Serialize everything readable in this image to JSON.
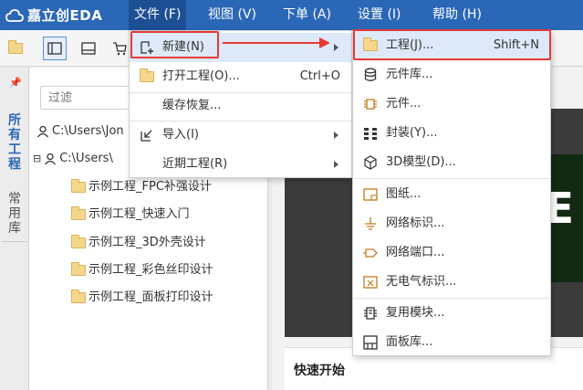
{
  "app": {
    "logo_text": "嘉立创EDA"
  },
  "menubar": {
    "file": "文件 (F)",
    "view": "视图 (V)",
    "order": "下单 (A)",
    "settings": "设置 (I)",
    "help": "帮助 (H)"
  },
  "panel": {
    "rail_tabs": [
      "所有工程",
      "常用库"
    ],
    "filter_placeholder": "过滤",
    "tree": [
      {
        "label": "C:\\Users\\Jon"
      },
      {
        "label": "C:\\Users\\"
      },
      {
        "label": "示例工程_FPC补强设计"
      },
      {
        "label": "示例工程_快速入门"
      },
      {
        "label": "示例工程_3D外壳设计"
      },
      {
        "label": "示例工程_彩色丝印设计"
      },
      {
        "label": "示例工程_面板打印设计"
      }
    ]
  },
  "file_menu": {
    "new": "新建(N)",
    "open_project": "打开工程(O)...",
    "open_shortcut": "Ctrl+O",
    "cache_restore": "缓存恢复...",
    "import": "导入(I)",
    "recent": "近期工程(R)"
  },
  "new_menu": {
    "items": [
      {
        "label": "工程(J)...",
        "shortcut": "Shift+N",
        "icon": "folder-icon"
      },
      {
        "label": "元件库...",
        "icon": "database-icon"
      },
      {
        "label": "元件...",
        "icon": "chip-icon"
      },
      {
        "label": "封装(Y)...",
        "icon": "footprint-icon"
      },
      {
        "label": "3D模型(D)...",
        "icon": "cube-icon"
      },
      {
        "label": "图纸...",
        "icon": "sheet-icon"
      },
      {
        "label": "网络标识...",
        "icon": "ground-icon"
      },
      {
        "label": "网络端口...",
        "icon": "port-icon"
      },
      {
        "label": "无电气标识...",
        "icon": "no-erc-icon"
      },
      {
        "label": "复用模块...",
        "icon": "module-icon"
      },
      {
        "label": "面板库...",
        "icon": "panel-icon"
      }
    ]
  },
  "work": {
    "banner_text": "E",
    "quick_start": "快速开始"
  },
  "colors": {
    "menubar": "#2b67b7",
    "highlight_box": "#e53935",
    "folder": "#f5d78b"
  }
}
